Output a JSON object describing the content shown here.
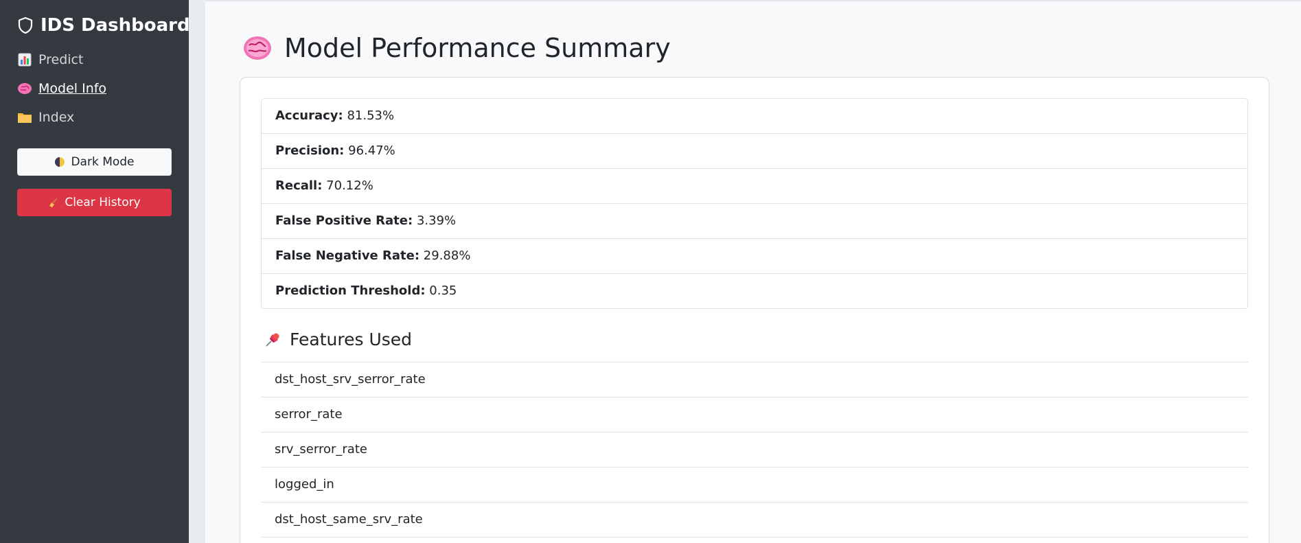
{
  "sidebar": {
    "brand": "IDS Dashboard",
    "brand_icon": "shield-icon",
    "nav": [
      {
        "label": "Predict",
        "icon": "bar-chart-icon"
      },
      {
        "label": "Model Info",
        "icon": "brain-icon",
        "active": true
      },
      {
        "label": "Index",
        "icon": "folder-icon"
      }
    ],
    "dark_mode_label": "Dark Mode",
    "clear_history_label": "Clear History"
  },
  "main": {
    "title": "Model Performance Summary",
    "metrics": [
      {
        "label": "Accuracy:",
        "value": "81.53%"
      },
      {
        "label": "Precision:",
        "value": "96.47%"
      },
      {
        "label": "Recall:",
        "value": "70.12%"
      },
      {
        "label": "False Positive Rate:",
        "value": "3.39%"
      },
      {
        "label": "False Negative Rate:",
        "value": "29.88%"
      },
      {
        "label": "Prediction Threshold:",
        "value": "0.35"
      }
    ],
    "features_title": "Features Used",
    "features": [
      "dst_host_srv_serror_rate",
      "serror_rate",
      "srv_serror_rate",
      "logged_in",
      "dst_host_same_srv_rate"
    ]
  },
  "colors": {
    "sidebar_bg": "#343a40",
    "danger": "#dc3545",
    "page_bg": "#f8f9fa"
  }
}
